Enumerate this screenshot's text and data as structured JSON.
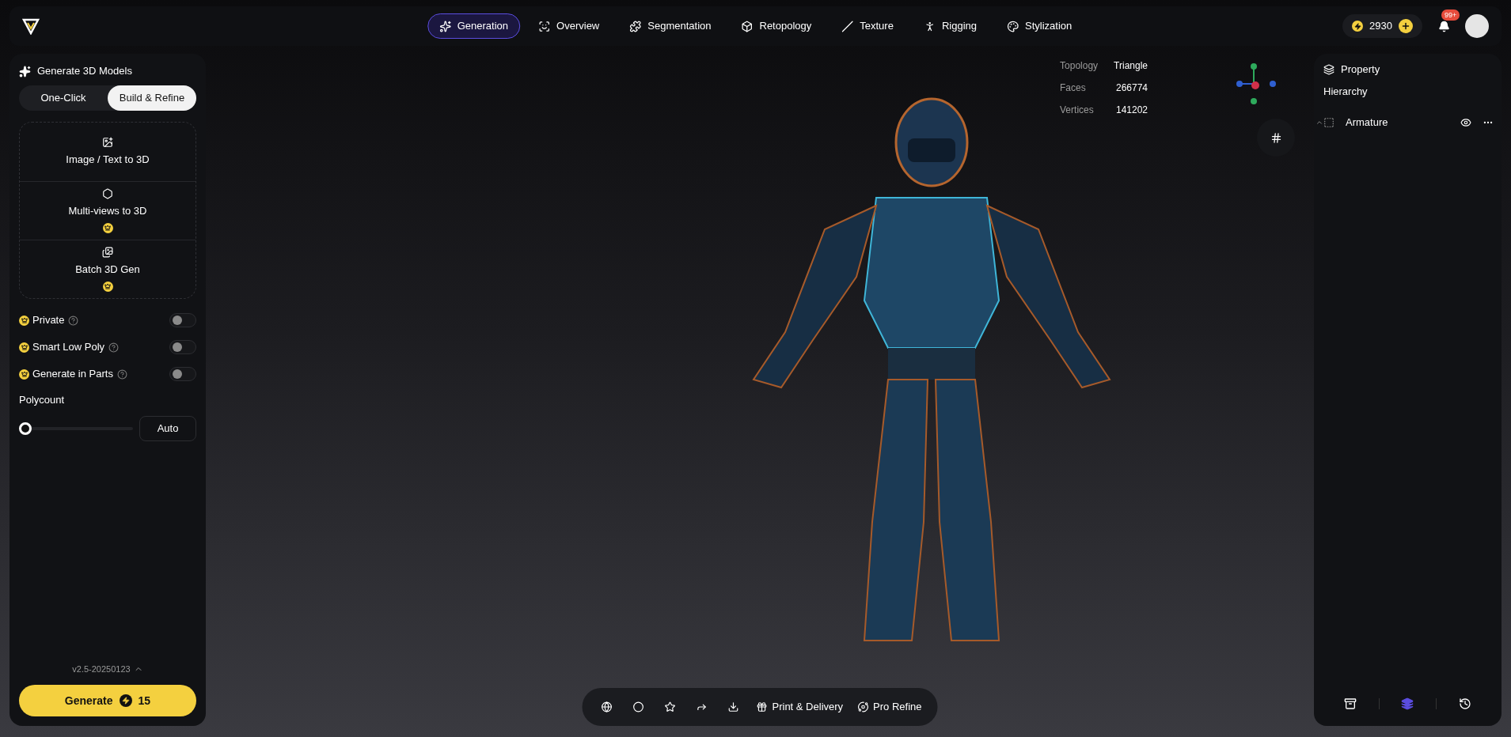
{
  "top_nav": {
    "tabs": [
      {
        "label": "Generation",
        "selected": true
      },
      {
        "label": "Overview",
        "selected": false
      },
      {
        "label": "Segmentation",
        "selected": false
      },
      {
        "label": "Retopology",
        "selected": false
      },
      {
        "label": "Texture",
        "selected": false
      },
      {
        "label": "Rigging",
        "selected": false
      },
      {
        "label": "Stylization",
        "selected": false
      }
    ],
    "credits": "2930",
    "notification_badge": "99+"
  },
  "generate_panel": {
    "title": "Generate 3D Models",
    "modes": [
      {
        "label": "One-Click",
        "selected": false
      },
      {
        "label": "Build & Refine",
        "selected": true
      }
    ],
    "methods": [
      {
        "label": "Image / Text to 3D",
        "premium": false
      },
      {
        "label": "Multi-views to 3D",
        "premium": true
      },
      {
        "label": "Batch 3D Gen",
        "premium": true
      }
    ],
    "options": [
      {
        "label": "Private",
        "premium": true,
        "on": false
      },
      {
        "label": "Smart Low Poly",
        "premium": true,
        "on": false
      },
      {
        "label": "Generate in Parts",
        "premium": true,
        "on": false
      }
    ],
    "polycount": {
      "label": "Polycount",
      "level": 0,
      "value": "Auto"
    },
    "version": "v2.5-20250123",
    "generate_button": {
      "label": "Generate",
      "cost": "15"
    }
  },
  "viewport": {
    "stats": [
      {
        "label": "Topology",
        "value": "Triangle"
      },
      {
        "label": "Faces",
        "value": "266774"
      },
      {
        "label": "Vertices",
        "value": "141202"
      }
    ],
    "toolbar": [
      {
        "label": "Print & Delivery"
      },
      {
        "label": "Pro Refine"
      }
    ]
  },
  "property_panel": {
    "title": "Property",
    "section": "Hierarchy",
    "items": [
      {
        "label": "Armature",
        "expanded": true
      }
    ],
    "footer_tabs": [
      {
        "selected": false
      },
      {
        "selected": true
      },
      {
        "selected": false
      }
    ]
  }
}
